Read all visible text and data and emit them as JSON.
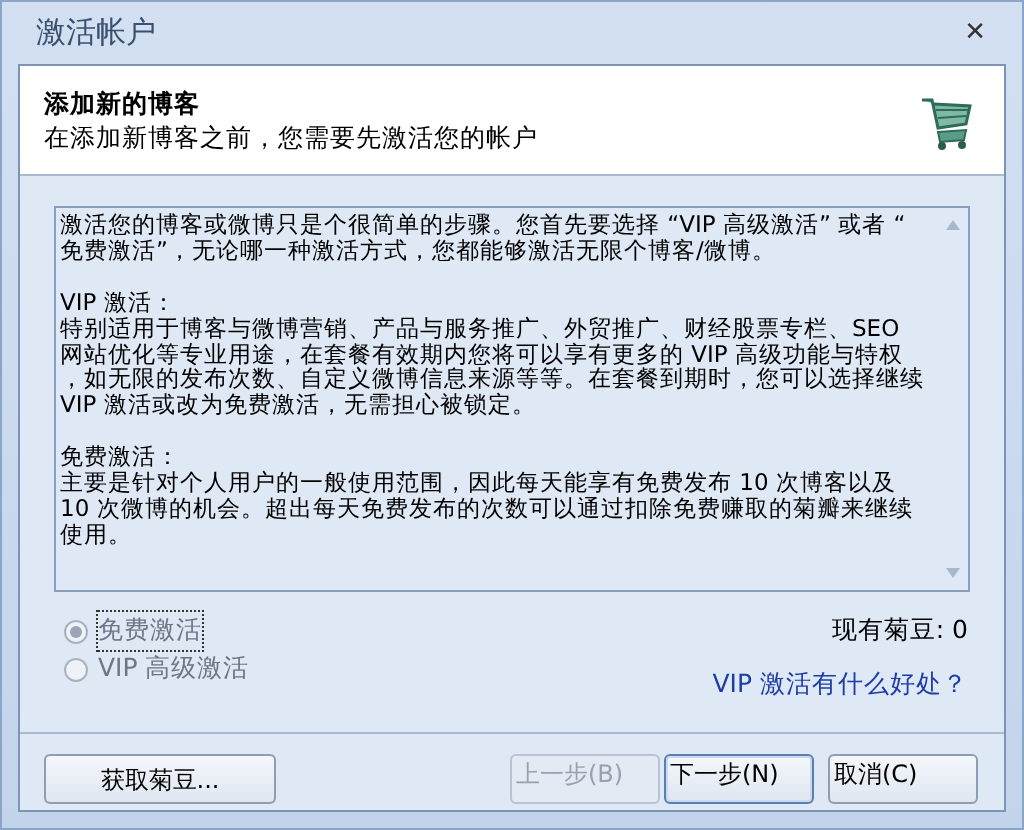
{
  "window": {
    "title": "激活帐户",
    "close": "✕"
  },
  "header": {
    "title": "添加新的博客",
    "subtitle": "在添加新博客之前，您需要先激活您的帐户"
  },
  "info_sections": [
    {
      "lines": [
        "激活您的博客或微博只是个很简单的步骤。您首先要选择 “VIP 高级激活” 或者 “",
        "免费激活”，无论哪一种激活方式，您都能够激活无限个博客/微博。"
      ]
    },
    {
      "heading": "VIP 激活：",
      "lines": [
        "特别适用于博客与微博营销、产品与服务推广、外贸推广、财经股票专栏、SEO",
        "网站优化等专业用途，在套餐有效期内您将可以享有更多的 VIP 高级功能与特权",
        "，如无限的发布次数、自定义微博信息来源等等。在套餐到期时，您可以选择继续",
        "VIP 激活或改为免费激活，无需担心被锁定。"
      ]
    },
    {
      "heading": "免费激活：",
      "lines": [
        "主要是针对个人用户的一般使用范围，因此每天能享有免费发布 10 次博客以及",
        "10 次微博的机会。超出每天免费发布的次数可以通过扣除免费赚取的菊瓣来继续",
        "使用。"
      ]
    }
  ],
  "options": [
    {
      "label": "免费激活",
      "selected": true,
      "disabled": true
    },
    {
      "label": "VIP 高级激活",
      "selected": false,
      "disabled": true
    }
  ],
  "balance": "现有菊豆: 0",
  "link": "VIP 激活有什么好处？",
  "buttons": [
    {
      "label": "获取菊豆...",
      "disabled": false,
      "default": false
    },
    {
      "label": "上一步(B)",
      "disabled": true,
      "default": false
    },
    {
      "label": "下一步(N)",
      "disabled": false,
      "default": true
    },
    {
      "label": "取消(C)",
      "disabled": false,
      "default": false
    }
  ]
}
